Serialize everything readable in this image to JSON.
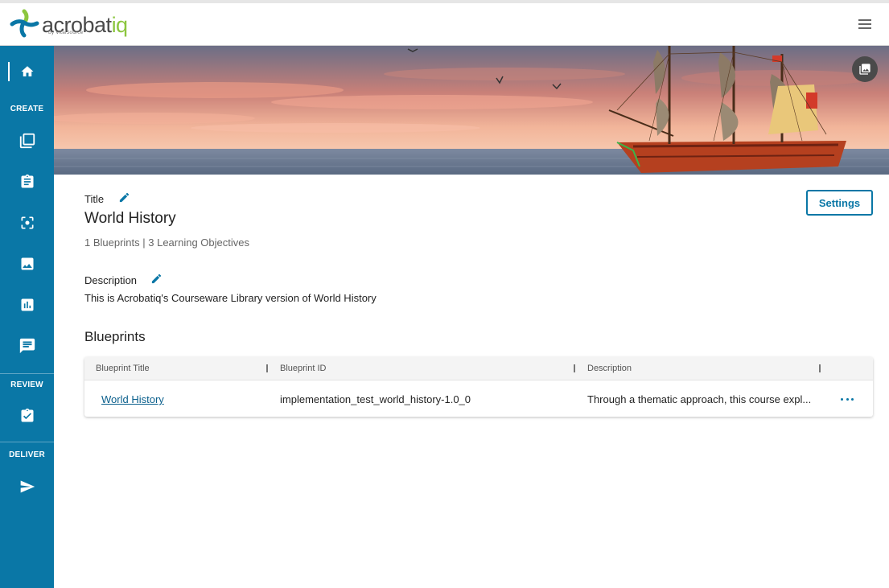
{
  "app": {
    "logo_text_main": "acrobat",
    "logo_text_accent": "iq",
    "logo_sub": "by VitalSource",
    "accent_color": "#0a77a6",
    "brand_green": "#8cc63f"
  },
  "topbar": {
    "menu_icon": "hamburger-menu-icon"
  },
  "sidebar": {
    "home_icon": "home-icon",
    "sections": [
      {
        "label": "CREATE",
        "items": [
          "copy-icon",
          "clipboard-icon",
          "focus-icon",
          "image-icon",
          "bar-chart-icon",
          "comment-icon"
        ]
      },
      {
        "label": "REVIEW",
        "items": [
          "assignment-check-icon"
        ]
      },
      {
        "label": "DELIVER",
        "items": [
          "send-icon"
        ]
      }
    ]
  },
  "banner": {
    "image_button_icon": "image-icon"
  },
  "course": {
    "title_label": "Title",
    "title": "World History",
    "meta": "1 Blueprints | 3 Learning Objectives",
    "description_label": "Description",
    "description": "This is Acrobatiq's Courseware Library version of World History",
    "settings_label": "Settings"
  },
  "blueprints": {
    "heading": "Blueprints",
    "columns": [
      "Blueprint Title",
      "Blueprint ID",
      "Description"
    ],
    "rows": [
      {
        "title": "World History",
        "id": "implementation_test_world_history-1.0_0",
        "description": "Through a thematic approach, this course expl..."
      }
    ]
  }
}
